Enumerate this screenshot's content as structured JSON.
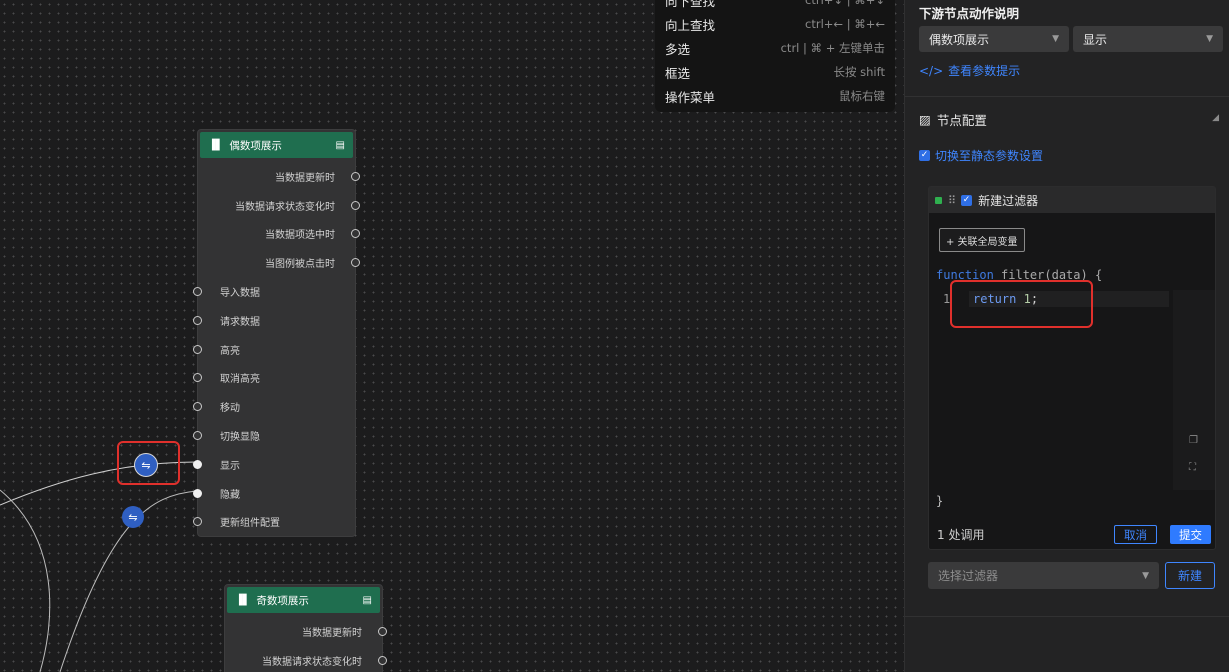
{
  "shortcuts": [
    {
      "label": "向下查找",
      "key": "ctrl+↓ | ⌘+↓"
    },
    {
      "label": "向上查找",
      "key": "ctrl+← | ⌘+←"
    },
    {
      "label": "多选",
      "key": "ctrl | ⌘ + 左键单击"
    },
    {
      "label": "框选",
      "key": "长按 shift"
    },
    {
      "label": "操作菜单",
      "key": "鼠标右键"
    }
  ],
  "node_even": {
    "title": "偶数项展示",
    "outputs": [
      "当数据更新时",
      "当数据请求状态变化时",
      "当数据项选中时",
      "当图例被点击时"
    ],
    "inputs": [
      "导入数据",
      "请求数据",
      "高亮",
      "取消高亮",
      "移动",
      "切换显隐",
      "显示",
      "隐藏",
      "更新组件配置"
    ]
  },
  "node_odd": {
    "title": "奇数项展示",
    "outputs": [
      "当数据更新时",
      "当数据请求状态变化时"
    ]
  },
  "panel": {
    "downstream_title": "下游节点动作说明",
    "select_node": "偶数项展示",
    "select_action": "显示",
    "param_hint_link": "查看参数提示",
    "node_config_title": "节点配置",
    "static_switch_link": "切换至静态参数设置",
    "filter": {
      "name": "新建过滤器",
      "global_var_button": "+ 关联全局变量",
      "signature_kw": "function",
      "signature_rest": " filter(data) {",
      "line_no": "1",
      "code_kw": "return",
      "code_num": "1",
      "code_end": ";",
      "close": "}",
      "usage": "1 处调用",
      "cancel": "取消",
      "submit": "提交"
    },
    "filter_select_placeholder": "选择过滤器",
    "new_button": "新建"
  },
  "colors": {
    "accent": "#2f7bff",
    "node_header": "#1f6e4f",
    "highlight": "#e0302c"
  }
}
